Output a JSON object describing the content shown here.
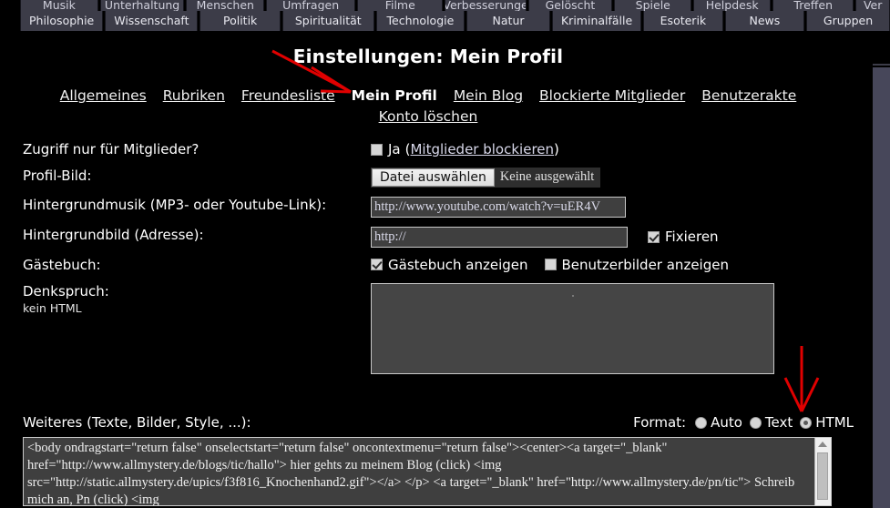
{
  "topnav": {
    "row_partial": [
      "Musik",
      "Unterhaltung",
      "Menschen",
      "Umfragen",
      "Filme",
      "Verbesserunge",
      "Gelöscht",
      "Spiele",
      "Helpdesk",
      "Treffen",
      "Ver"
    ],
    "row_main": [
      "Philosophie",
      "Wissenschaft",
      "Politik",
      "Spiritualität",
      "Technologie",
      "Natur",
      "Kriminalfälle",
      "Esoterik",
      "News",
      "Gruppen"
    ]
  },
  "header": {
    "title": "Einstellungen: Mein Profil"
  },
  "tabs": {
    "row1": [
      {
        "label": "Allgemeines",
        "active": false
      },
      {
        "label": "Rubriken",
        "active": false
      },
      {
        "label": "Freundesliste",
        "active": false
      },
      {
        "label": "Mein Profil",
        "active": true
      },
      {
        "label": "Mein Blog",
        "active": false
      },
      {
        "label": "Blockierte Mitglieder",
        "active": false
      },
      {
        "label": "Benutzerakte",
        "active": false
      }
    ],
    "row2": [
      {
        "label": "Konto löschen",
        "active": false
      }
    ]
  },
  "form": {
    "access": {
      "label": "Zugriff nur für Mitglieder?",
      "checkbox_label": "Ja",
      "paren_open": "(",
      "link_label": "Mitglieder blockieren",
      "paren_close": ")",
      "checked": false
    },
    "profile_image": {
      "label": "Profil-Bild:",
      "button_label": "Datei auswählen",
      "file_status": "Keine ausgewählt"
    },
    "background_music": {
      "label": "Hintergrundmusik (MP3- oder Youtube-Link):",
      "value": "http://www.youtube.com/watch?v=uER4V",
      "placeholder": "http://"
    },
    "background_image": {
      "label": "Hintergrundbild (Adresse):",
      "value": "http://",
      "placeholder": "http://",
      "fix_label": "Fixieren",
      "fix_checked": true
    },
    "guestbook": {
      "label": "Gästebuch:",
      "show_guestbook_label": "Gästebuch anzeigen",
      "show_guestbook_checked": true,
      "show_userimages_label": "Benutzerbilder anzeigen",
      "show_userimages_checked": false
    },
    "motto": {
      "label": "Denkspruch:",
      "sublabel": "kein HTML",
      "value": ""
    },
    "more": {
      "label": "Weiteres (Texte, Bilder, Style, ...):",
      "format_label": "Format:",
      "options": [
        {
          "label": "Auto",
          "selected": false
        },
        {
          "label": "Text",
          "selected": false
        },
        {
          "label": "HTML",
          "selected": true
        }
      ],
      "value": "<body ondragstart=\"return false\" onselectstart=\"return false\" oncontextmenu=\"return false\"><center><a target=\"_blank\" href=\"http://www.allmystery.de/blogs/tic/hallo\"> hier gehts zu meinem Blog (click) <img src=\"http://static.allmystery.de/upics/f3f816_Knochenhand2.gif\"></a> </p> <a target=\"_blank\" href=\"http://www.allmystery.de/pn/tic\"> Schreib mich an, Pn (click) <img"
    }
  },
  "annotations": {
    "arrow_to_tab_color": "#e00000",
    "arrow_to_html_color": "#e00000"
  }
}
